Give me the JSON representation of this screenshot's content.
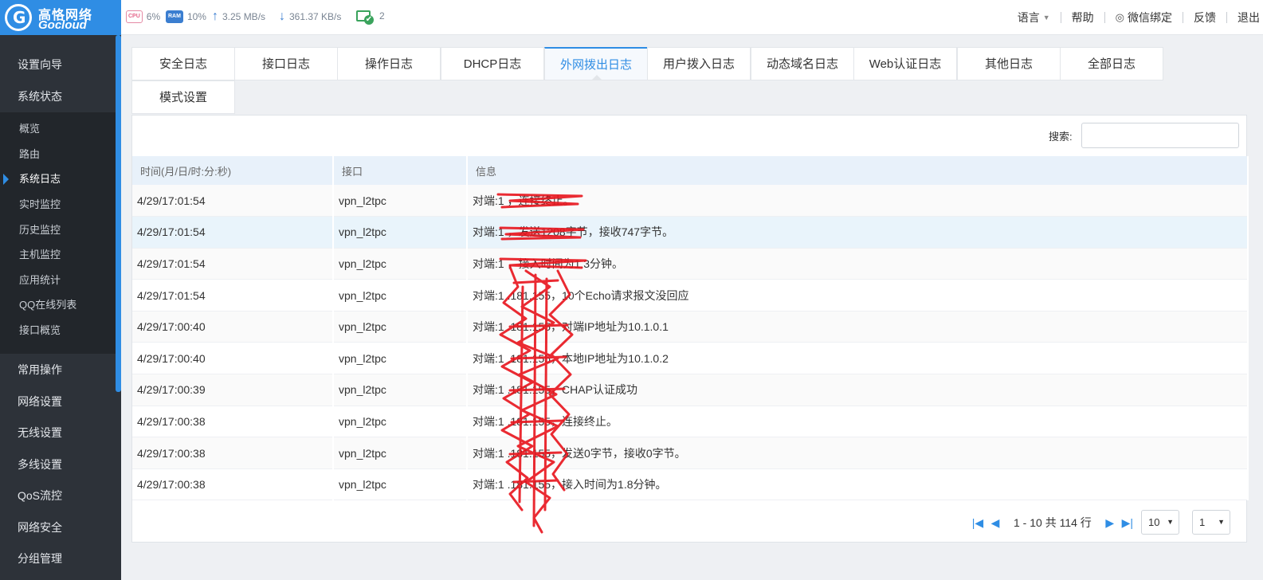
{
  "header": {
    "logo_cn": "高恪网络",
    "logo_en": "Gocloud",
    "cpu_label": "CPU",
    "cpu_value": "6%",
    "ram_label": "RAM",
    "ram_value": "10%",
    "upload": "3.25 MB/s",
    "download": "361.37 KB/s",
    "devices": "2",
    "nav": {
      "language": "语言",
      "help": "帮助",
      "wechat": "微信绑定",
      "feedback": "反馈",
      "logout": "退出"
    }
  },
  "sidebar": {
    "menu_top": [
      "设置向导",
      "系统状态"
    ],
    "submenu": [
      "概览",
      "路由",
      "系统日志",
      "实时监控",
      "历史监控",
      "主机监控",
      "应用统计",
      "QQ在线列表",
      "接口概览"
    ],
    "active_sub": "系统日志",
    "menu_bottom": [
      "常用操作",
      "网络设置",
      "无线设置",
      "多线设置",
      "QoS流控",
      "网络安全",
      "分组管理"
    ]
  },
  "tabs": [
    "安全日志",
    "接口日志",
    "操作日志",
    "DHCP日志",
    "外网拨出日志",
    "用户拨入日志",
    "动态域名日志",
    "Web认证日志",
    "其他日志",
    "全部日志",
    "模式设置"
  ],
  "active_tab": "外网拨出日志",
  "search": {
    "label": "搜索:",
    "value": ""
  },
  "table": {
    "columns": [
      "时间(月/日/时:分:秒)",
      "接口",
      "信息"
    ],
    "rows": [
      [
        "4/29/17:01:54",
        "vpn_l2tpc",
        "对端:1              ，连接终止。"
      ],
      [
        "4/29/17:01:54",
        "vpn_l2tpc",
        "对端:1              ，发送1208字节，接收747字节。"
      ],
      [
        "4/29/17:01:54",
        "vpn_l2tpc",
        "对端:1              ，接入时间为1.3分钟。"
      ],
      [
        "4/29/17:01:54",
        "vpn_l2tpc",
        "对端:1     .181.155，10个Echo请求报文没回应"
      ],
      [
        "4/29/17:00:40",
        "vpn_l2tpc",
        "对端:1     .181.155，对端IP地址为10.1.0.1"
      ],
      [
        "4/29/17:00:40",
        "vpn_l2tpc",
        "对端:1     .181.155，本地IP地址为10.1.0.2"
      ],
      [
        "4/29/17:00:39",
        "vpn_l2tpc",
        "对端:1     .181.155，CHAP认证成功"
      ],
      [
        "4/29/17:00:38",
        "vpn_l2tpc",
        "对端:1     .181.155，连接终止。"
      ],
      [
        "4/29/17:00:38",
        "vpn_l2tpc",
        "对端:1     .181.155，发送0字节，接收0字节。"
      ],
      [
        "4/29/17:00:38",
        "vpn_l2tpc",
        "对端:1     .181.155，接入时间为1.8分钟。"
      ]
    ]
  },
  "pagination": {
    "info": "1 - 10 共 114 行",
    "page_size": "10",
    "page": "1"
  }
}
